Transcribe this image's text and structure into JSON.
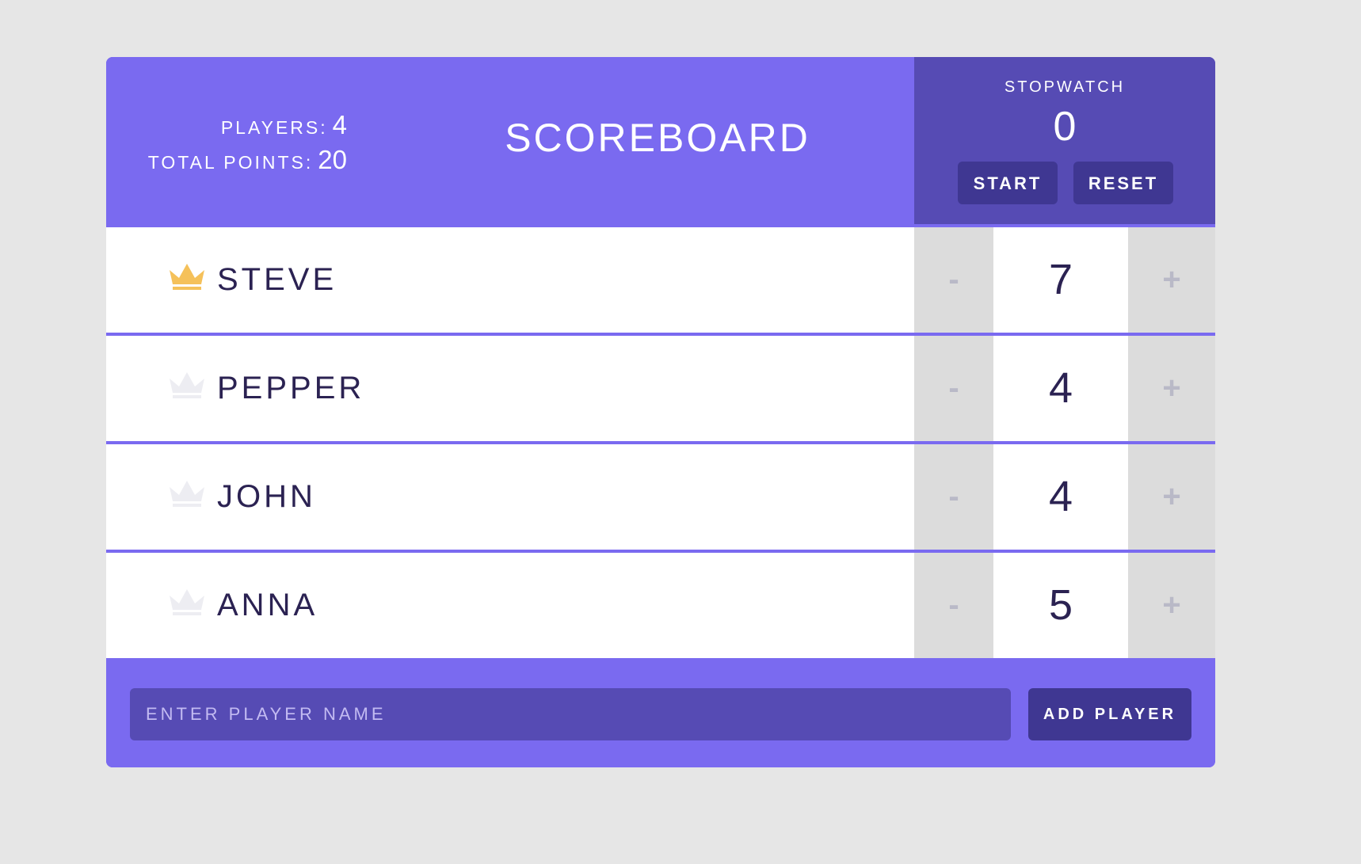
{
  "header": {
    "players_label": "PLAYERS:",
    "players_count": "4",
    "points_label": "TOTAL POINTS:",
    "points_total": "20",
    "title": "SCOREBOARD"
  },
  "stopwatch": {
    "title": "STOPWATCH",
    "time": "0",
    "start_label": "START",
    "reset_label": "RESET"
  },
  "players": [
    {
      "name": "STEVE",
      "score": "7",
      "leader": true
    },
    {
      "name": "PEPPER",
      "score": "4",
      "leader": false
    },
    {
      "name": "JOHN",
      "score": "4",
      "leader": false
    },
    {
      "name": "ANNA",
      "score": "5",
      "leader": false
    }
  ],
  "controls": {
    "decrement_label": "-",
    "increment_label": "+"
  },
  "footer": {
    "input_placeholder": "ENTER PLAYER NAME",
    "add_label": "ADD PLAYER"
  },
  "icons": {
    "crown": "crown-icon"
  },
  "colors": {
    "header_bg": "#7a6af0",
    "stopwatch_bg": "#564bb4",
    "button_bg": "#3f3792",
    "text_dark": "#2b2252",
    "crown_active": "#f5c15a",
    "crown_inactive": "#ededf2",
    "counter_bg": "#dcdcdc"
  }
}
